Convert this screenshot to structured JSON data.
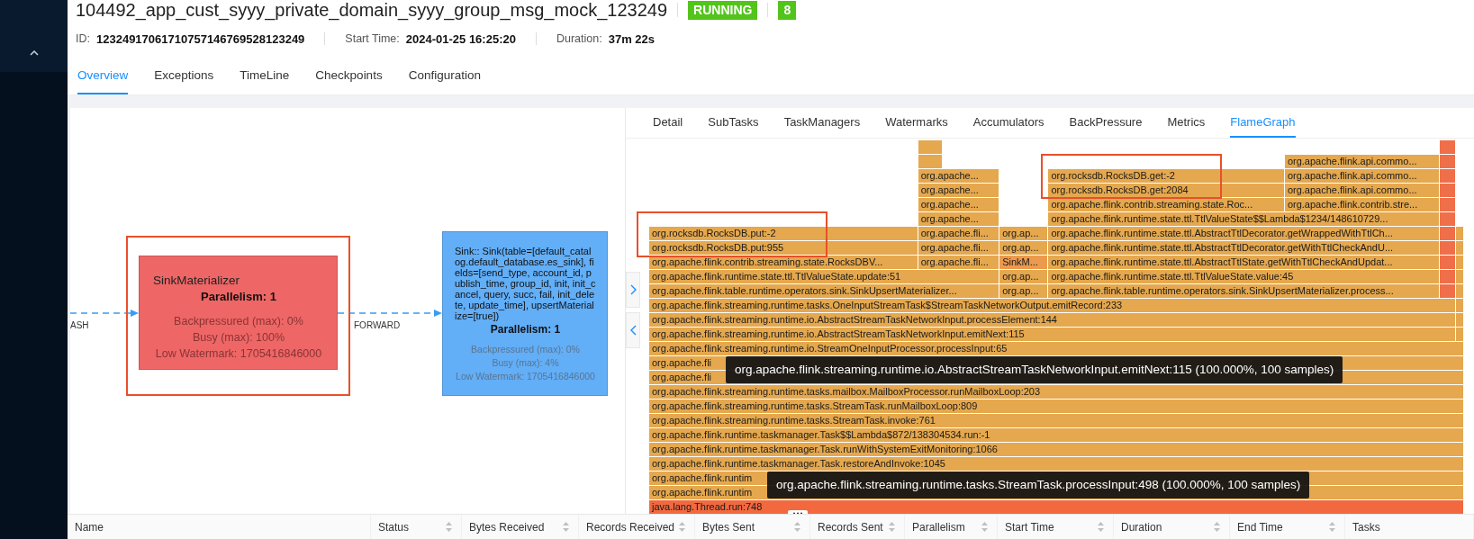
{
  "job": {
    "title": "104492_app_cust_syyy_private_domain_syyy_group_msg_mock_123249",
    "status": "RUNNING",
    "count": "8",
    "info": [
      {
        "label": "ID:",
        "value": "12324917061710757146769528123249"
      },
      {
        "label": "Start Time:",
        "value": "2024-01-25 16:25:20"
      },
      {
        "label": "Duration:",
        "value": "37m 22s"
      }
    ]
  },
  "tabs": [
    {
      "label": "Overview",
      "selected": true
    },
    {
      "label": "Exceptions",
      "selected": false
    },
    {
      "label": "TimeLine",
      "selected": false
    },
    {
      "label": "Checkpoints",
      "selected": false
    },
    {
      "label": "Configuration",
      "selected": false
    }
  ],
  "graph": {
    "edges": [
      {
        "label": "ASH"
      },
      {
        "label": "FORWARD"
      }
    ],
    "nodes": [
      {
        "kind": "operator",
        "color": "#ee6666",
        "name": "SinkMaterializer",
        "parallelism": "Parallelism: 1",
        "metrics": [
          "Backpressured (max): 0%",
          "Busy (max): 100%",
          "Low Watermark: 1705416846000"
        ]
      },
      {
        "kind": "sink",
        "color": "#62aef7",
        "name": "Sink:: Sink(table=[default_catalog.default_database.es_sink], fields=[send_type, account_id, publish_time, group_id, init, init_cancel, query, succ, fail, init_delete, update_time], upsertMaterialize=[true])",
        "parallelism": "Parallelism: 1",
        "metrics": [
          "Backpressured (max): 0%",
          "Busy (max): 4%",
          "Low Watermark: 1705416846000"
        ]
      }
    ]
  },
  "detail_tabs": [
    {
      "label": "Detail",
      "selected": false
    },
    {
      "label": "SubTasks",
      "selected": false
    },
    {
      "label": "TaskManagers",
      "selected": false
    },
    {
      "label": "Watermarks",
      "selected": false
    },
    {
      "label": "Accumulators",
      "selected": false
    },
    {
      "label": "BackPressure",
      "selected": false
    },
    {
      "label": "Metrics",
      "selected": false
    },
    {
      "label": "FlameGraph",
      "selected": true
    }
  ],
  "flame_graph": {
    "rows": [
      {
        "frames": [
          {
            "color": "#e5a84e"
          },
          {
            "color": "#ef6f4a"
          }
        ]
      },
      {
        "frames": [
          {
            "color": "#e5a84e"
          },
          {
            "label": "org.apache.flink.api.commo...",
            "color": "#e5a84e"
          },
          {
            "color": "#ef6f4a"
          }
        ]
      },
      {
        "frames": [
          {
            "label": "org.apache...",
            "color": "#e5a84e"
          },
          {
            "label": "org.rocksdb.RocksDB.get:-2",
            "color": "#e5a84e"
          },
          {
            "label": "org.apache.flink.api.commo...",
            "color": "#e5a84e"
          },
          {
            "color": "#ef6f4a"
          }
        ]
      },
      {
        "frames": [
          {
            "label": "org.apache...",
            "color": "#e5a84e"
          },
          {
            "label": "org.rocksdb.RocksDB.get:2084",
            "color": "#e5a84e"
          },
          {
            "label": "org.apache.flink.api.commo...",
            "color": "#e5a84e"
          },
          {
            "color": "#ef6f4a"
          }
        ]
      },
      {
        "frames": [
          {
            "label": "org.apache...",
            "color": "#e5a84e"
          },
          {
            "label": "org.apache.flink.contrib.streaming.state.Roc...",
            "color": "#e5a84e"
          },
          {
            "label": "org.apache.flink.contrib.stre...",
            "color": "#e5a84e"
          },
          {
            "color": "#ef6f4a"
          }
        ]
      },
      {
        "frames": [
          {
            "label": "org.apache...",
            "color": "#e5a84e"
          },
          {
            "label": "org.apache.flink.runtime.state.ttl.TtlValueState$$Lambda$1234/148610729...",
            "color": "#e5a84e"
          },
          {
            "color": "#ef6f4a"
          }
        ]
      },
      {
        "frames": [
          {
            "label": "org.rocksdb.RocksDB.put:-2",
            "color": "#e5a84e"
          },
          {
            "label": "org.apache.fli...",
            "color": "#e5a84e"
          },
          {
            "label": "org.ap...",
            "color": "#e5a84e"
          },
          {
            "label": "org.apache.flink.runtime.state.ttl.AbstractTtlDecorator.getWrappedWithTtlCh...",
            "color": "#e5a84e"
          },
          {
            "color": "#ef6f4a"
          },
          {
            "color": "#e5a84e"
          }
        ]
      },
      {
        "frames": [
          {
            "label": "org.rocksdb.RocksDB.put:955",
            "color": "#e5a84e"
          },
          {
            "label": "org.apache.fli...",
            "color": "#e5a84e"
          },
          {
            "label": "org.ap...",
            "color": "#e5a84e"
          },
          {
            "label": "org.apache.flink.runtime.state.ttl.AbstractTtlDecorator.getWithTtlCheckAndU...",
            "color": "#e5a84e"
          },
          {
            "color": "#ef6f4a"
          },
          {
            "color": "#e5a84e"
          }
        ]
      },
      {
        "frames": [
          {
            "label": "org.apache.flink.contrib.streaming.state.RocksDBV...",
            "color": "#e5a84e"
          },
          {
            "label": "org.apache.fli...",
            "color": "#e5a84e"
          },
          {
            "label": "SinkM...",
            "color": "#ec9a4e"
          },
          {
            "label": "org.apache.flink.runtime.state.ttl.AbstractTtlState.getWithTtlCheckAndUpdat...",
            "color": "#e5a84e"
          },
          {
            "color": "#ef6f4a"
          },
          {
            "color": "#e5a84e"
          }
        ]
      },
      {
        "frames": [
          {
            "label": "org.apache.flink.runtime.state.ttl.TtlValueState.update:51",
            "color": "#e5a84e"
          },
          {
            "label": "org.ap...",
            "color": "#e5a84e"
          },
          {
            "label": "org.apache.flink.runtime.state.ttl.TtlValueState.value:45",
            "color": "#e5a84e"
          },
          {
            "color": "#ef6f4a"
          },
          {
            "color": "#e5a84e"
          }
        ]
      },
      {
        "frames": [
          {
            "label": "org.apache.flink.table.runtime.operators.sink.SinkUpsertMaterializer...",
            "color": "#e5a84e"
          },
          {
            "label": "org.ap...",
            "color": "#e5a84e"
          },
          {
            "label": "org.apache.flink.table.runtime.operators.sink.SinkUpsertMaterializer.process...",
            "color": "#e5a84e"
          },
          {
            "color": "#ef6f4a"
          },
          {
            "color": "#e5a84e"
          }
        ]
      },
      {
        "frames": [
          {
            "label": "org.apache.flink.streaming.runtime.tasks.OneInputStreamTask$StreamTaskNetworkOutput.emitRecord:233",
            "color": "#e5a84e"
          },
          {
            "color": "#e5a84e"
          }
        ]
      },
      {
        "frames": [
          {
            "label": "org.apache.flink.streaming.runtime.io.AbstractStreamTaskNetworkInput.processElement:144",
            "color": "#e5a84e"
          },
          {
            "color": "#e5a84e"
          }
        ]
      },
      {
        "frames": [
          {
            "label": "org.apache.flink.streaming.runtime.io.AbstractStreamTaskNetworkInput.emitNext:115",
            "color": "#e5a84e"
          },
          {
            "color": "#e5a84e"
          }
        ]
      },
      {
        "frames": [
          {
            "label": "org.apache.flink.streaming.runtime.io.StreamOneInputProcessor.processInput:65",
            "color": "#e5a84e"
          }
        ]
      },
      {
        "frames": [
          {
            "label": "org.apache.fli"
          }
        ]
      },
      {
        "frames": [
          {
            "label": "org.apache.fli"
          }
        ]
      },
      {
        "frames": [
          {
            "label": "org.apache.flink.streaming.runtime.tasks.mailbox.MailboxProcessor.runMailboxLoop:203",
            "color": "#e5a84e"
          }
        ]
      },
      {
        "frames": [
          {
            "label": "org.apache.flink.streaming.runtime.tasks.StreamTask.runMailboxLoop:809",
            "color": "#e5a84e"
          }
        ]
      },
      {
        "frames": [
          {
            "label": "org.apache.flink.streaming.runtime.tasks.StreamTask.invoke:761",
            "color": "#e5a84e"
          }
        ]
      },
      {
        "frames": [
          {
            "label": "org.apache.flink.runtime.taskmanager.Task$$Lambda$872/138304534.run:-1",
            "color": "#e5a84e"
          }
        ]
      },
      {
        "frames": [
          {
            "label": "org.apache.flink.runtime.taskmanager.Task.runWithSystemExitMonitoring:1066",
            "color": "#e5a84e"
          }
        ]
      },
      {
        "frames": [
          {
            "label": "org.apache.flink.runtime.taskmanager.Task.restoreAndInvoke:1045",
            "color": "#e5a84e"
          }
        ]
      },
      {
        "frames": [
          {
            "label": "org.apache.flink.runtim"
          }
        ]
      },
      {
        "frames": [
          {
            "label": "org.apache.flink.runtim"
          }
        ]
      },
      {
        "frames": [
          {
            "label": "java.lang.Thread.run:748",
            "color": "#f2693f"
          }
        ]
      }
    ],
    "tooltips": [
      "org.apache.flink.streaming.runtime.io.AbstractStreamTaskNetworkInput.emitNext:115 (100.000%, 100 samples)",
      "org.apache.flink.streaming.runtime.tasks.StreamTask.processInput:498 (100.000%, 100 samples)"
    ]
  },
  "table": {
    "columns": [
      {
        "label": "Name",
        "sortable": false
      },
      {
        "label": "Status",
        "sortable": true
      },
      {
        "label": "Bytes Received",
        "sortable": true
      },
      {
        "label": "Records Received",
        "sortable": true
      },
      {
        "label": "Bytes Sent",
        "sortable": true
      },
      {
        "label": "Records Sent",
        "sortable": true
      },
      {
        "label": "Parallelism",
        "sortable": true
      },
      {
        "label": "Start Time",
        "sortable": true
      },
      {
        "label": "Duration",
        "sortable": true
      },
      {
        "label": "End Time",
        "sortable": true
      },
      {
        "label": "Tasks",
        "sortable": false
      }
    ]
  }
}
